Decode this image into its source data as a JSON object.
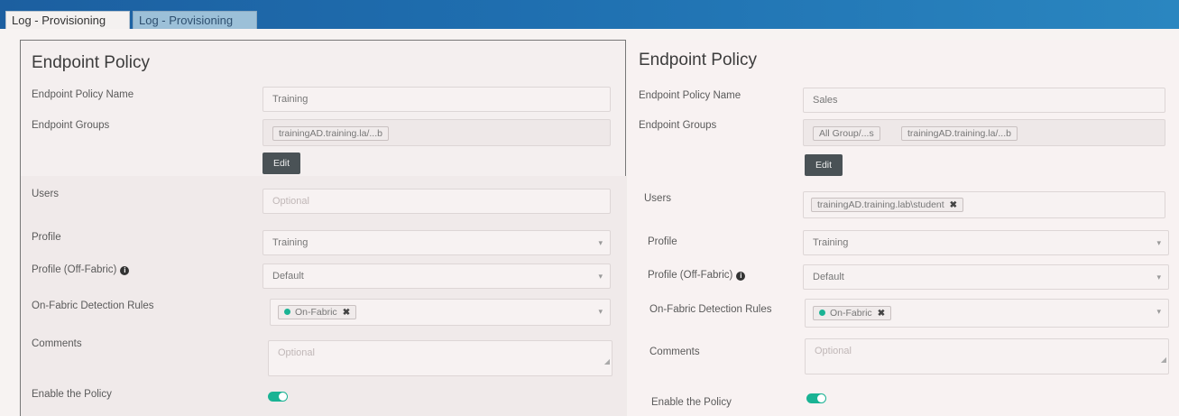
{
  "tabs": [
    {
      "label": "Log - Provisioning",
      "active": true
    },
    {
      "label": "Log - Provisioning",
      "active": false
    }
  ],
  "left": {
    "title": "Endpoint Policy",
    "labels": {
      "name": "Endpoint Policy Name",
      "groups": "Endpoint Groups",
      "users": "Users",
      "profile": "Profile",
      "profile_off": "Profile (Off-Fabric)",
      "detection": "On-Fabric Detection Rules",
      "comments": "Comments",
      "enable": "Enable the Policy"
    },
    "name_value": "Training",
    "groups": [
      "trainingAD.training.la/...b"
    ],
    "edit_label": "Edit",
    "users_placeholder": "Optional",
    "profile_value": "Training",
    "profile_off_value": "Default",
    "detection_tag": "On-Fabric",
    "comments_placeholder": "Optional",
    "enabled": true
  },
  "right": {
    "title": "Endpoint Policy",
    "labels": {
      "name": "Endpoint Policy Name",
      "groups": "Endpoint Groups",
      "users": "Users",
      "profile": "Profile",
      "profile_off": "Profile (Off-Fabric)",
      "detection": "On-Fabric Detection Rules",
      "comments": "Comments",
      "enable": "Enable the Policy"
    },
    "name_value": "Sales",
    "groups": [
      "All Group/...s",
      "trainingAD.training.la/...b"
    ],
    "edit_label": "Edit",
    "user_tag": "trainingAD.training.lab\\student",
    "profile_value": "Training",
    "profile_off_value": "Default",
    "detection_tag": "On-Fabric",
    "comments_placeholder": "Optional",
    "enabled": true
  },
  "colors": {
    "accent": "#1ab394",
    "topbar": "#1f6fb0",
    "edit_button": "#4a5256"
  },
  "icons": [
    "info-icon",
    "chevron-down-icon",
    "remove-tag-icon",
    "status-dot-icon",
    "resize-grip-icon"
  ]
}
